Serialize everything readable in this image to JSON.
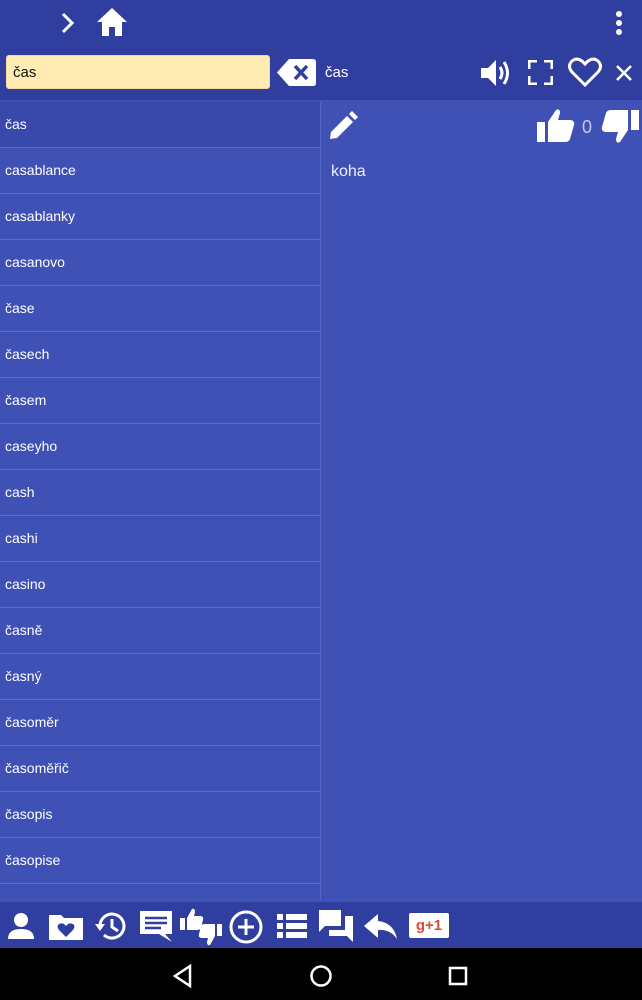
{
  "search": {
    "value": "čas",
    "echo": "čas"
  },
  "word_list": [
    "čas",
    "casablance",
    "casablanky",
    "casanovo",
    "čase",
    "časech",
    "časem",
    "caseyho",
    "cash",
    "cashi",
    "casino",
    "časně",
    "časný",
    "časoměr",
    "časoměřič",
    "časopis",
    "časopise"
  ],
  "detail": {
    "translation": "koha",
    "like_count": "0"
  },
  "bottom_toolbar": {
    "gplus_label": "g+1"
  },
  "colors": {
    "bar": "#303f9f",
    "panel": "#3f51b5",
    "selected_row": "#3949ab",
    "search_bg": "#ffecb3"
  },
  "icons": [
    "chevron-right-icon",
    "home-icon",
    "more-vert-icon",
    "backspace-icon",
    "volume-icon",
    "fullscreen-icon",
    "heart-outline-icon",
    "close-icon",
    "edit-icon",
    "thumb-up-icon",
    "thumb-down-icon",
    "person-icon",
    "favorites-folder-icon",
    "history-icon",
    "comment-icon",
    "thumbs-icon",
    "add-circle-icon",
    "list-icon",
    "forum-icon",
    "reply-icon",
    "gplus-icon",
    "nav-back-icon",
    "nav-home-icon",
    "nav-recents-icon"
  ]
}
